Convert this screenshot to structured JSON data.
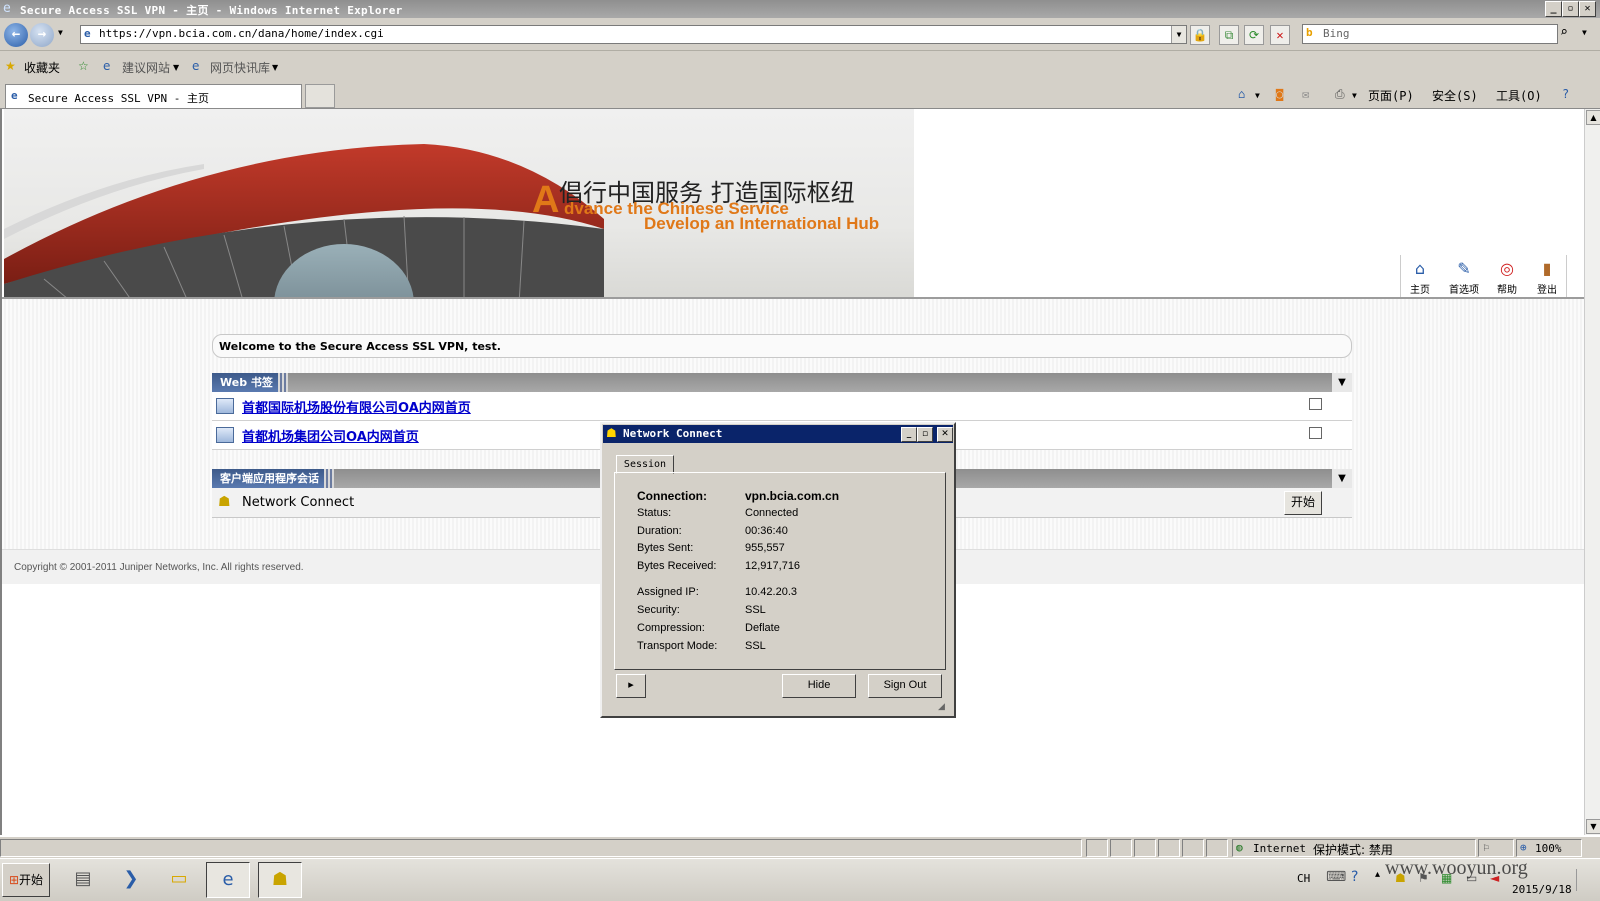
{
  "window": {
    "title": "Secure Access SSL VPN - 主页 - Windows Internet Explorer"
  },
  "addressbar": {
    "url": "https://vpn.bcia.com.cn/dana/home/index.cgi",
    "search_placeholder": "Bing"
  },
  "favorites": {
    "label": "收藏夹",
    "items": [
      "建议网站",
      "网页快讯库"
    ]
  },
  "tab": {
    "label": "Secure Access SSL VPN - 主页"
  },
  "commands": {
    "page": "页面(P)",
    "safety": "安全(S)",
    "tools": "工具(O)"
  },
  "banner": {
    "slogan_cn": "倡行中国服务 打造国际枢纽",
    "slogan_en_first": "A",
    "slogan_en_1": "dvance the Chinese Service",
    "slogan_en_2": "Develop an International Hub"
  },
  "toolbar": {
    "home": "主页",
    "preferences": "首选项",
    "help": "帮助",
    "logout": "登出"
  },
  "page": {
    "welcome": "Welcome to the Secure Access SSL VPN, test.",
    "web_bookmarks_header": "Web 书签",
    "bookmarks": [
      "首都国际机场股份有限公司OA内网首页",
      "首都机场集团公司OA内网首页"
    ],
    "client_apps_header": "客户端应用程序会话",
    "network_connect_label": "Network Connect",
    "start_button": "开始",
    "copyright": "Copyright © 2001-2011 Juniper Networks, Inc. All rights reserved."
  },
  "dialog": {
    "title": "Network Connect",
    "tab": "Session",
    "rows": [
      {
        "k": "Connection:",
        "v": "vpn.bcia.com.cn"
      },
      {
        "k": "Status:",
        "v": "Connected"
      },
      {
        "k": "Duration:",
        "v": "00:36:40"
      },
      {
        "k": "Bytes Sent:",
        "v": "955,557"
      },
      {
        "k": "Bytes Received:",
        "v": "12,917,716"
      },
      {
        "k": "Assigned IP:",
        "v": "10.42.20.3"
      },
      {
        "k": "Security:",
        "v": "SSL"
      },
      {
        "k": "Compression:",
        "v": "Deflate"
      },
      {
        "k": "Transport Mode:",
        "v": "SSL"
      }
    ],
    "hide_button": "Hide",
    "signout_button": "Sign Out",
    "expand_button": "▸"
  },
  "statusbar": {
    "zone": "Internet",
    "protected_mode": "保护模式: 禁用",
    "zoom": "100%"
  },
  "taskbar": {
    "start": "开始",
    "lang": "CH",
    "date": "2015/9/18",
    "watermark": "www.wooyun.org"
  },
  "colors": {
    "accent": "#0a246a",
    "slogan_orange": "#e07818",
    "link": "#0000cc"
  }
}
